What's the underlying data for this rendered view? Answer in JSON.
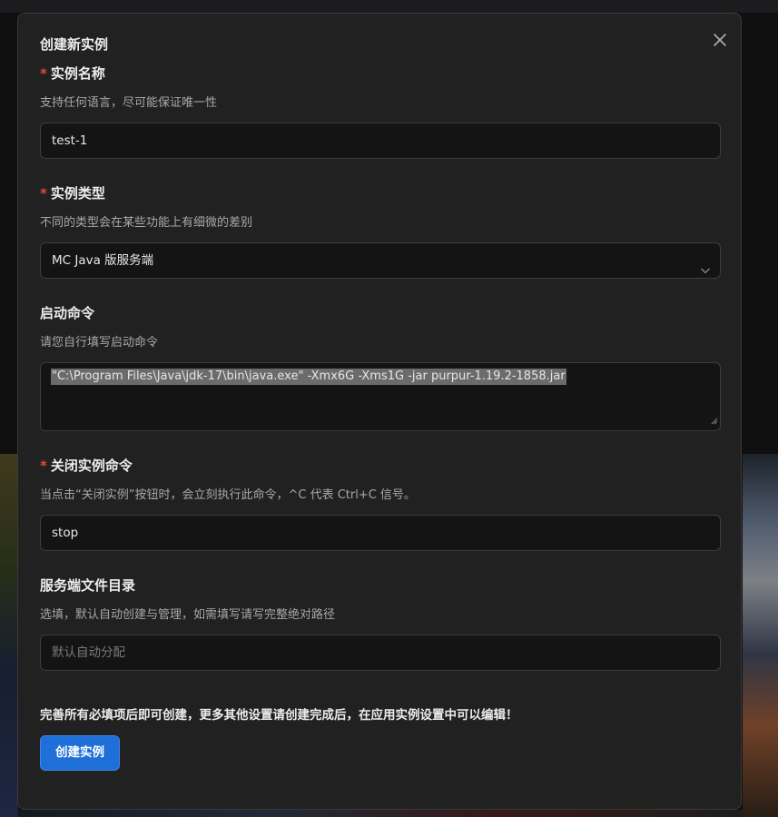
{
  "dialog": {
    "title": "创建新实例",
    "close_icon": "close-icon"
  },
  "fields": {
    "name": {
      "label": "实例名称",
      "required": "*",
      "description": "支持任何语言，尽可能保证唯一性",
      "value": "test-1"
    },
    "type": {
      "label": "实例类型",
      "required": "*",
      "description": "不同的类型会在某些功能上有细微的差别",
      "selected": "MC Java 版服务端"
    },
    "start_command": {
      "label": "启动命令",
      "description": "请您自行填写启动命令",
      "value": "\"C:\\Program Files\\Java\\jdk-17\\bin\\java.exe\" -Xmx6G -Xms1G -jar purpur-1.19.2-1858.jar"
    },
    "stop_command": {
      "label": "关闭实例命令",
      "required": "*",
      "description": "当点击“关闭实例”按钮时，会立刻执行此命令，^C 代表 Ctrl+C 信号。",
      "value": "stop"
    },
    "directory": {
      "label": "服务端文件目录",
      "description": "选填，默认自动创建与管理，如需填写请写完整绝对路径",
      "placeholder": "默认自动分配"
    }
  },
  "footer": {
    "note": "完善所有必填项后即可创建，更多其他设置请创建完成后，在应用实例设置中可以编辑！",
    "create_button": "创建实例"
  },
  "colors": {
    "accent": "#1f6fd8",
    "required": "#e04a3a",
    "dialog_bg": "#212121",
    "input_bg": "#141414"
  }
}
